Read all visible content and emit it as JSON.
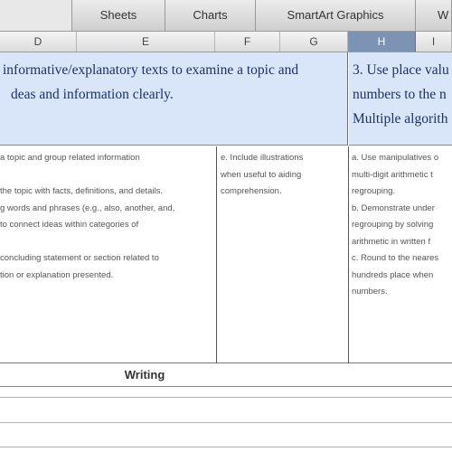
{
  "ribbon": {
    "tabs": [
      {
        "label": ""
      },
      {
        "label": "Sheets"
      },
      {
        "label": "Charts"
      },
      {
        "label": "SmartArt Graphics"
      },
      {
        "label": "W"
      }
    ]
  },
  "columns": [
    "D",
    "E",
    "F",
    "G",
    "H",
    "I"
  ],
  "selected_column": "H",
  "header": {
    "left_lines": [
      "informative/explanatory texts to examine a topic and",
      "deas and information clearly."
    ],
    "right_lines": [
      "3. Use place valu",
      "numbers to the n",
      "Multiple algorith"
    ]
  },
  "details": {
    "col_de_lines": [
      "a topic and group related information",
      "",
      "the topic with facts, definitions, and details.",
      "g words and phrases (e.g., also, another, and,",
      "to connect ideas within categories of",
      "",
      "concluding statement or section related to",
      "tion or explanation presented."
    ],
    "col_fg_lines": [
      "e. Include illustrations",
      "when useful to aiding",
      "comprehension."
    ],
    "col_hi_lines": [
      "a. Use manipulatives o",
      "multi-digit arithmetic t",
      "regrouping.",
      "b. Demonstrate under",
      "regrouping by solving",
      "arithmetic in written f",
      "c. Round to the neares",
      "hundreds place when",
      "numbers."
    ]
  },
  "writing_row": {
    "label": "Writing"
  }
}
